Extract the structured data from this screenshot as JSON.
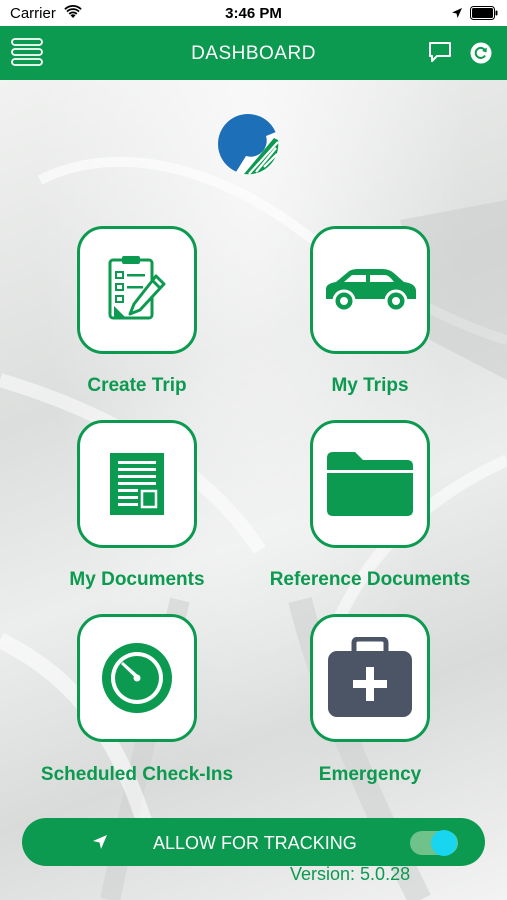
{
  "status_bar": {
    "carrier": "Carrier",
    "time": "3:46 PM"
  },
  "header": {
    "title": "DASHBOARD"
  },
  "tiles": [
    {
      "label": "Create Trip",
      "icon": "clipboard-pen-icon"
    },
    {
      "label": "My Trips",
      "icon": "car-icon"
    },
    {
      "label": "My Documents",
      "icon": "document-icon"
    },
    {
      "label": "Reference Documents",
      "icon": "folder-icon"
    },
    {
      "label": "Scheduled Check-Ins",
      "icon": "timer-icon"
    },
    {
      "label": "Emergency",
      "icon": "first-aid-kit-icon"
    }
  ],
  "tracking": {
    "label": "ALLOW FOR TRACKING",
    "enabled": true
  },
  "version": "Version: 5.0.28",
  "colors": {
    "brand_green": "#0b9a4f",
    "logo_blue": "#1d6fb8",
    "toggle_knob": "#19d6f0",
    "kit_gray": "#4c5566"
  }
}
